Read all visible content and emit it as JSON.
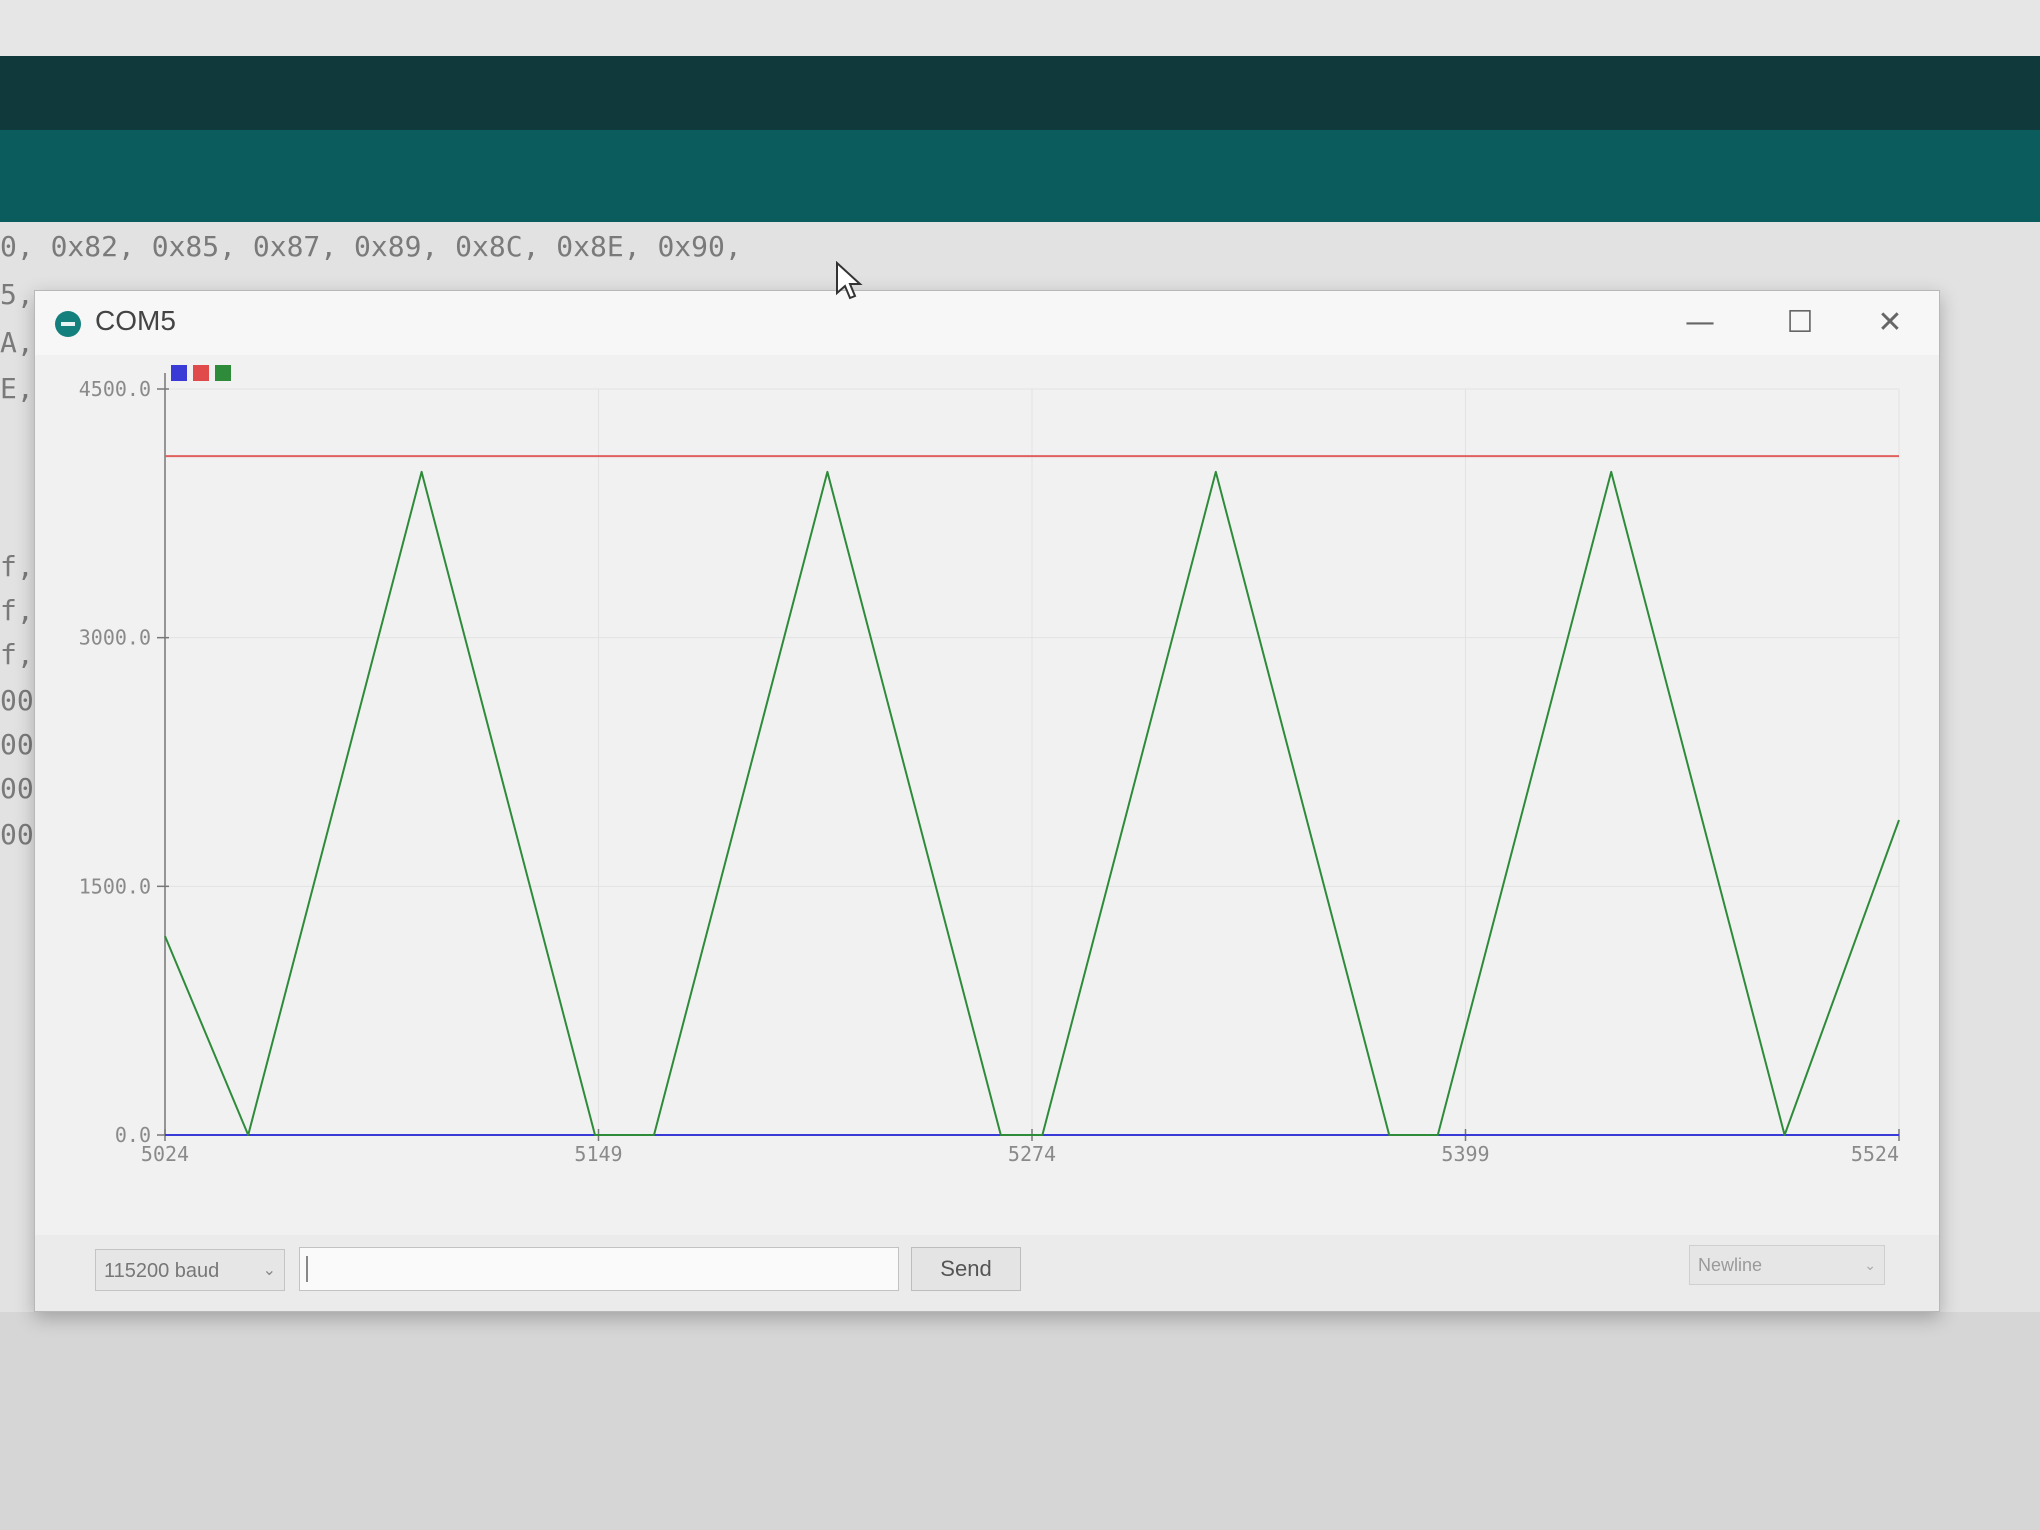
{
  "editor": {
    "lines": [
      "0, 0x82, 0x85, 0x87, 0x89, 0x8C, 0x8E, 0x90,",
      "5,",
      "A,",
      "E,",
      "f,",
      "f,",
      "f,",
      "00,",
      "00,",
      "00,",
      "00,"
    ]
  },
  "window": {
    "title": "COM5",
    "minimize_glyph": "—",
    "maximize_glyph": "☐",
    "close_glyph": "✕"
  },
  "legend": {
    "colors": [
      "#3a3ad6",
      "#e04a4a",
      "#2e8b3a"
    ]
  },
  "chart_data": {
    "type": "line",
    "y_ticks": [
      "0.0",
      "1500.0",
      "3000.0",
      "4500.0"
    ],
    "x_ticks": [
      "5024",
      "5149",
      "5274",
      "5399",
      "5524"
    ],
    "xlim": [
      5024,
      5524
    ],
    "ylim": [
      0,
      4500
    ],
    "series": [
      {
        "color": "#3a3ad6",
        "x": [
          5024,
          5524
        ],
        "y": [
          0,
          0
        ]
      },
      {
        "color": "#e06060",
        "x": [
          5024,
          5524
        ],
        "y": [
          4095,
          4095
        ]
      },
      {
        "color": "#2e8b3a",
        "x": [
          5024,
          5048,
          5098,
          5148,
          5165,
          5215,
          5265,
          5277,
          5327,
          5377,
          5391,
          5441,
          5491,
          5524
        ],
        "y": [
          1200,
          0,
          4000,
          0,
          0,
          4000,
          0,
          0,
          4000,
          0,
          0,
          4000,
          0,
          1900
        ]
      }
    ]
  },
  "bottombar": {
    "baud": "115200 baud",
    "send_label": "Send",
    "line_ending": "Newline",
    "input_value": ""
  }
}
